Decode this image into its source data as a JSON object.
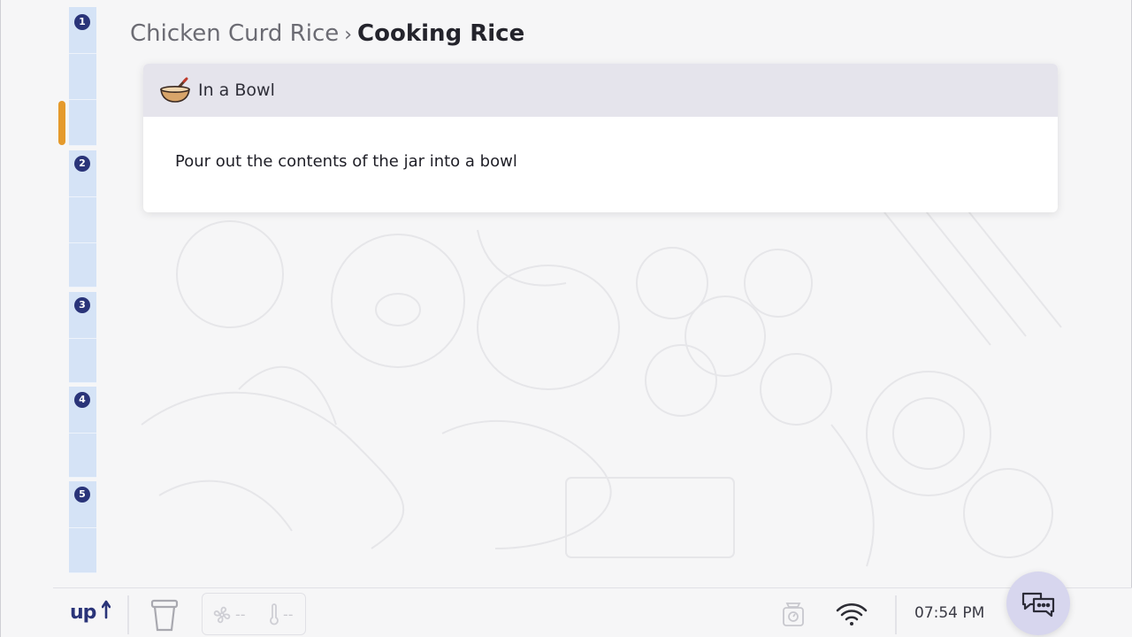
{
  "breadcrumb": {
    "parent": "Chicken Curd Rice",
    "separator": "›",
    "current": "Cooking Rice"
  },
  "step_card": {
    "icon": "mixing-bowl-icon",
    "title": "In a Bowl",
    "instruction": "Pour out the contents of the jar into a bowl"
  },
  "progress_rail": {
    "steps": [
      "1",
      "2",
      "3",
      "4",
      "5"
    ],
    "current_step": 1,
    "accent_color": "#e59a2c",
    "segment_color": "#d5e3f6",
    "badge_color": "#2a3479"
  },
  "bottom_bar": {
    "logo_text": "UP",
    "logo_icon": "brand-arrow-icon",
    "fan_value": "--",
    "temperature_value": "--",
    "clock": "07:54 PM"
  }
}
